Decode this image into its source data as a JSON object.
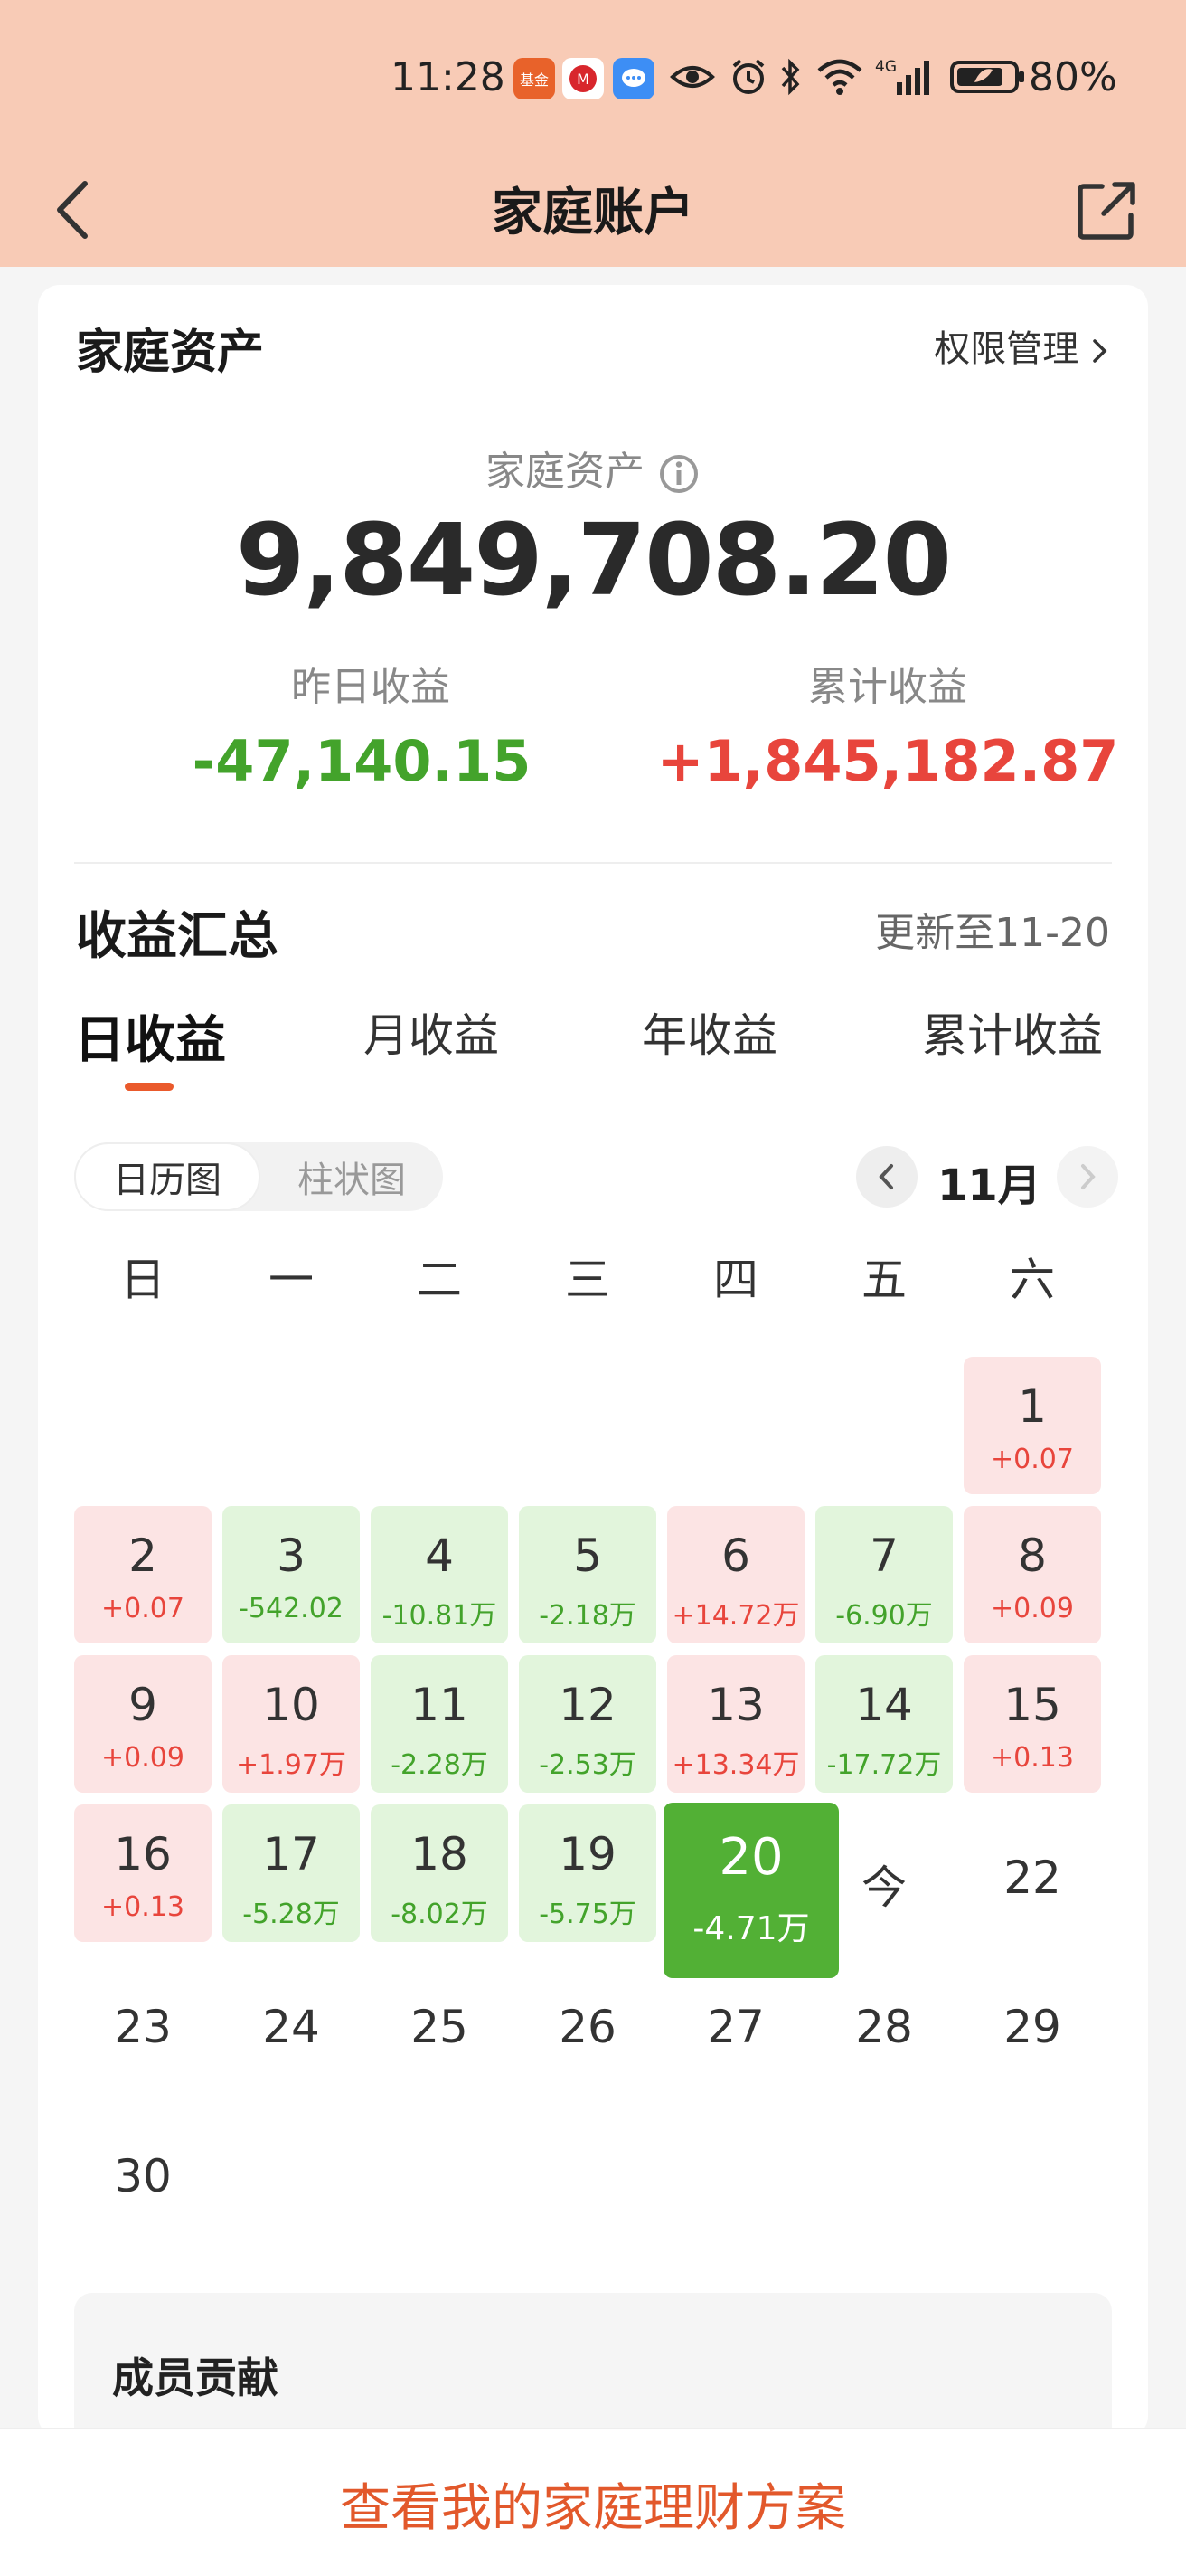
{
  "status_bar": {
    "time": "11:28",
    "apps": [
      "fund-app-icon",
      "cmb-bank-icon",
      "message-icon"
    ],
    "app_badge_fund": "基金",
    "network": "4G",
    "battery": "80%"
  },
  "header": {
    "title": "家庭账户"
  },
  "assets": {
    "section_title": "家庭资产",
    "permission_link": "权限管理",
    "label": "家庭资产",
    "total": "9,849,708.20",
    "yesterday_label": "昨日收益",
    "yesterday_value": "-47,140.15",
    "cumulative_label": "累计收益",
    "cumulative_value": "+1,845,182.87",
    "colors": {
      "positive": "#e8453c",
      "negative": "#43a32b"
    }
  },
  "summary": {
    "title": "收益汇总",
    "updated": "更新至11-20",
    "tabs": [
      "日收益",
      "月收益",
      "年收益",
      "累计收益"
    ],
    "active_tab": "日收益",
    "view_options": [
      "日历图",
      "柱状图"
    ],
    "active_view": "日历图",
    "month": "11月",
    "weekdays": [
      "日",
      "一",
      "二",
      "三",
      "四",
      "五",
      "六"
    ],
    "days": [
      {
        "d": "1",
        "v": "+0.07",
        "t": "pos"
      },
      {
        "d": "2",
        "v": "+0.07",
        "t": "pos"
      },
      {
        "d": "3",
        "v": "-542.02",
        "t": "neg"
      },
      {
        "d": "4",
        "v": "-10.81万",
        "t": "neg"
      },
      {
        "d": "5",
        "v": "-2.18万",
        "t": "neg"
      },
      {
        "d": "6",
        "v": "+14.72万",
        "t": "pos"
      },
      {
        "d": "7",
        "v": "-6.90万",
        "t": "neg"
      },
      {
        "d": "8",
        "v": "+0.09",
        "t": "pos"
      },
      {
        "d": "9",
        "v": "+0.09",
        "t": "pos"
      },
      {
        "d": "10",
        "v": "+1.97万",
        "t": "pos"
      },
      {
        "d": "11",
        "v": "-2.28万",
        "t": "neg"
      },
      {
        "d": "12",
        "v": "-2.53万",
        "t": "neg"
      },
      {
        "d": "13",
        "v": "+13.34万",
        "t": "pos"
      },
      {
        "d": "14",
        "v": "-17.72万",
        "t": "neg"
      },
      {
        "d": "15",
        "v": "+0.13",
        "t": "pos"
      },
      {
        "d": "16",
        "v": "+0.13",
        "t": "pos"
      },
      {
        "d": "17",
        "v": "-5.28万",
        "t": "neg"
      },
      {
        "d": "18",
        "v": "-8.02万",
        "t": "neg"
      },
      {
        "d": "19",
        "v": "-5.75万",
        "t": "neg"
      },
      {
        "d": "20",
        "v": "-4.71万",
        "t": "sel"
      },
      {
        "d": "今",
        "v": "",
        "t": "plain"
      },
      {
        "d": "22",
        "v": "",
        "t": "plain"
      },
      {
        "d": "23",
        "v": "",
        "t": "plain"
      },
      {
        "d": "24",
        "v": "",
        "t": "plain"
      },
      {
        "d": "25",
        "v": "",
        "t": "plain"
      },
      {
        "d": "26",
        "v": "",
        "t": "plain"
      },
      {
        "d": "27",
        "v": "",
        "t": "plain"
      },
      {
        "d": "28",
        "v": "",
        "t": "plain"
      },
      {
        "d": "29",
        "v": "",
        "t": "plain"
      },
      {
        "d": "30",
        "v": "",
        "t": "plain"
      }
    ]
  },
  "members": {
    "title": "成员贡献"
  },
  "bottom": {
    "cta": "查看我的家庭理财方案"
  }
}
